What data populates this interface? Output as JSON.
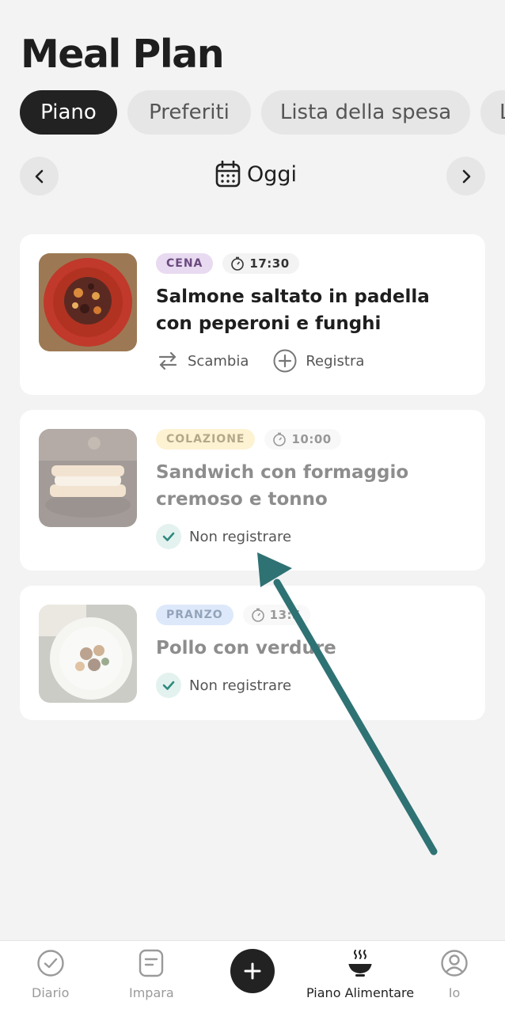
{
  "header": {
    "title": "Meal Plan"
  },
  "tabs": [
    {
      "label": "Piano",
      "active": true
    },
    {
      "label": "Preferiti",
      "active": false
    },
    {
      "label": "Lista della spesa",
      "active": false
    },
    {
      "label": "L",
      "active": false
    }
  ],
  "date_nav": {
    "label": "Oggi",
    "prev_icon": "chevron-left-icon",
    "next_icon": "chevron-right-icon",
    "calendar_icon": "calendar-icon"
  },
  "meals": [
    {
      "category": "CENA",
      "category_bg": "#e8daf0",
      "category_color": "#6a4a7e",
      "time": "17:30",
      "name": "Salmone saltato in padella con peperoni e funghi",
      "actions": {
        "swap": "Scambia",
        "log": "Registra"
      },
      "faded": false
    },
    {
      "category": "COLAZIONE",
      "category_bg": "#fdf1c8",
      "category_color": "#7a6420",
      "time": "10:00",
      "name": "Sandwich con formaggio cremoso e tonno",
      "status": "Non registrare",
      "faded": true
    },
    {
      "category": "PRANZO",
      "category_bg": "#dbe8fb",
      "category_color": "#3f5e8c",
      "time": "13:5",
      "name": "Pollo con verdure",
      "status": "Non registrare",
      "faded": true
    }
  ],
  "bottom_nav": {
    "items": [
      {
        "label": "Diario",
        "icon": "check-circle-icon",
        "active": false
      },
      {
        "label": "Impara",
        "icon": "note-icon",
        "active": false
      },
      {
        "label": "Piano Alimentare",
        "icon": "bowl-icon",
        "active": true
      },
      {
        "label": "Io",
        "icon": "user-circle-icon",
        "active": false
      }
    ],
    "add_icon": "plus-icon"
  },
  "colors": {
    "accent": "#2f7274",
    "active_tab": "#222222"
  }
}
